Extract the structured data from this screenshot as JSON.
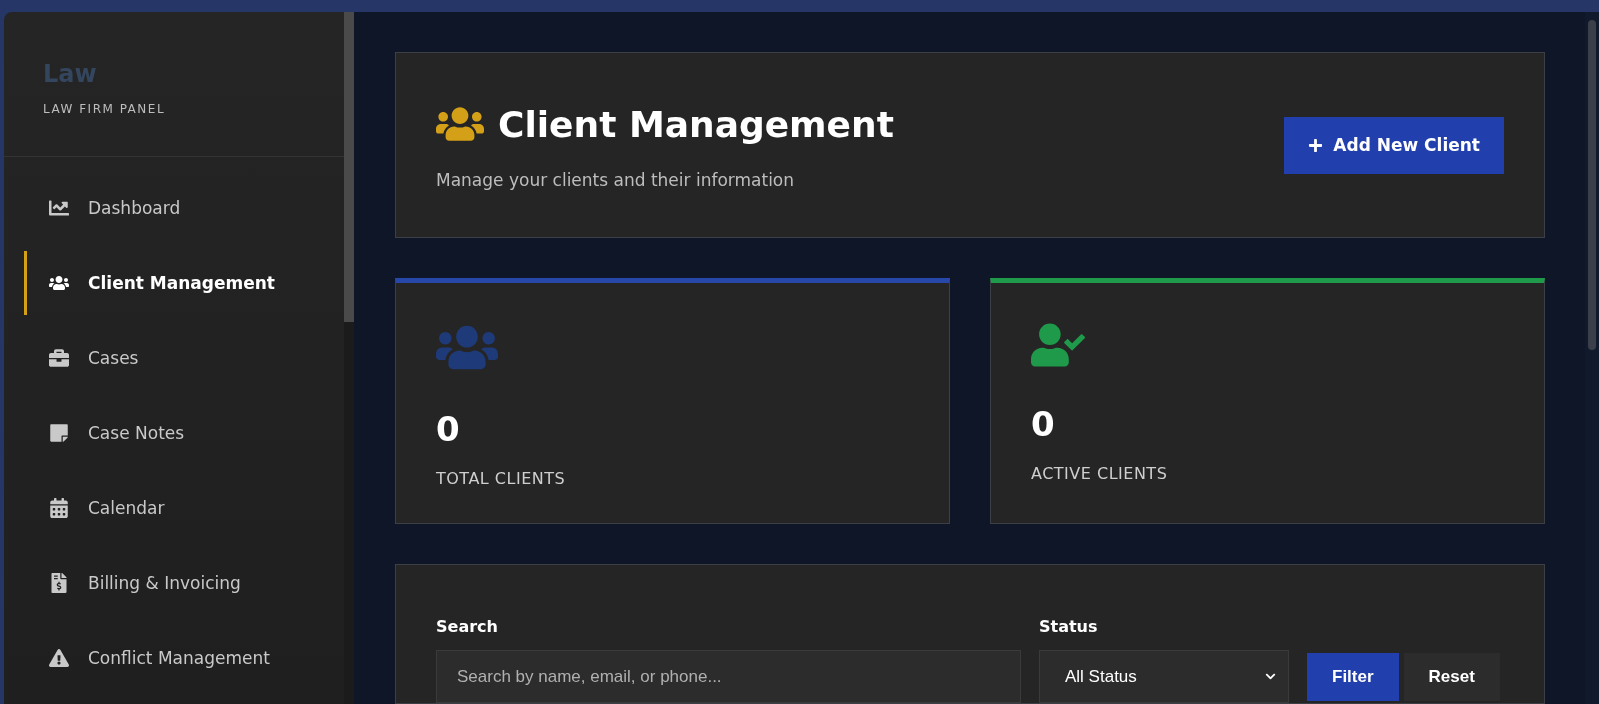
{
  "sidebar": {
    "brand": "Law",
    "subtitle": "LAW FIRM PANEL",
    "items": [
      {
        "label": "Dashboard",
        "selected": false
      },
      {
        "label": "Client Management",
        "selected": true
      },
      {
        "label": "Cases",
        "selected": false
      },
      {
        "label": "Case Notes",
        "selected": false
      },
      {
        "label": "Calendar",
        "selected": false
      },
      {
        "label": "Billing & Invoicing",
        "selected": false
      },
      {
        "label": "Conflict Management",
        "selected": false
      }
    ]
  },
  "header": {
    "title": "Client Management",
    "subtitle": "Manage your clients and their information",
    "button": "Add New Client"
  },
  "stats": [
    {
      "value": "0",
      "label": "TOTAL CLIENTS",
      "color": "#2748a8"
    },
    {
      "value": "0",
      "label": "ACTIVE CLIENTS",
      "color": "#1e9a4a"
    }
  ],
  "filters": {
    "search_label": "Search",
    "search_placeholder": "Search by name, email, or phone...",
    "status_label": "Status",
    "status_value": "All Status",
    "filter_button": "Filter",
    "reset_button": "Reset"
  }
}
